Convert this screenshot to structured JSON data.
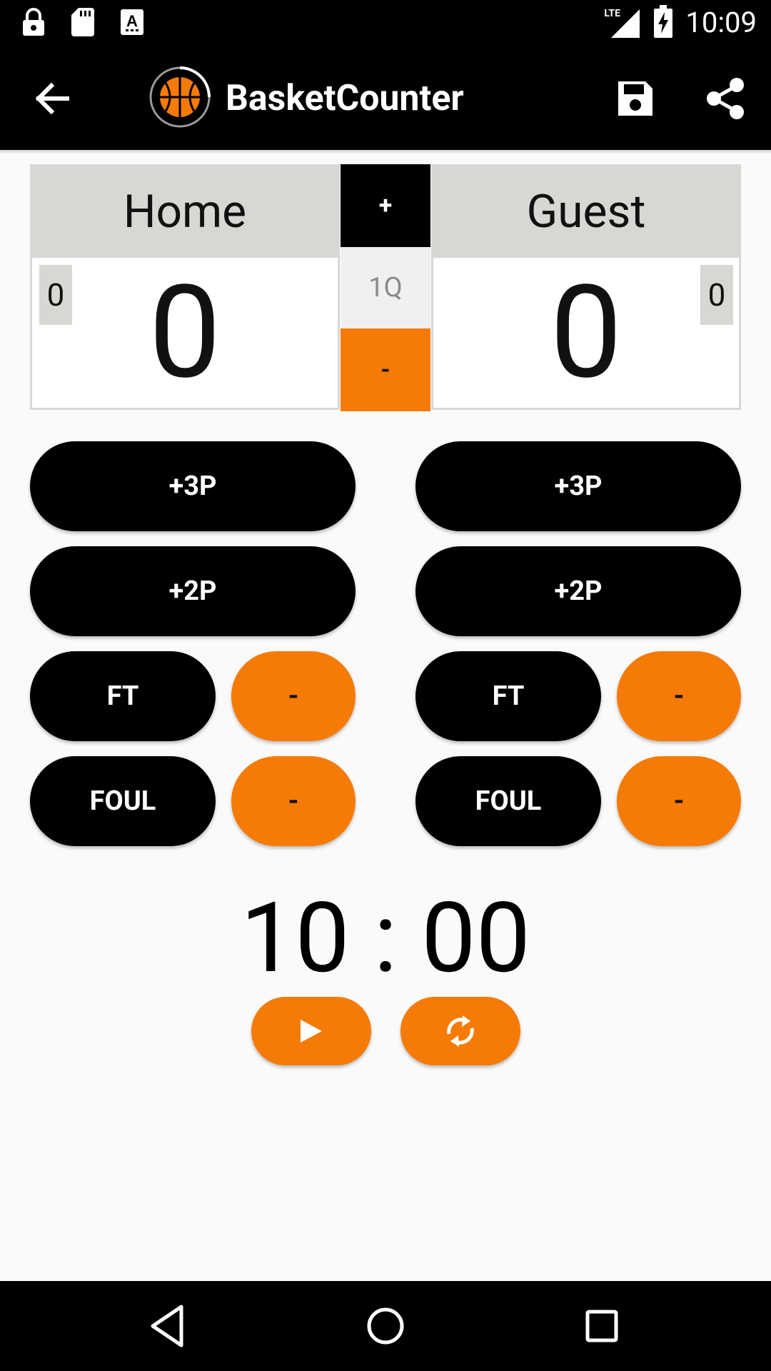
{
  "status_bar": {
    "time": "10:09",
    "network": "LTE",
    "icons": [
      "lock-icon",
      "sd-card-icon",
      "keyboard-a-icon",
      "signal-icon",
      "battery-charging-icon"
    ]
  },
  "app_bar": {
    "title": "BasketCounter",
    "icons": [
      "back-arrow-icon",
      "basketball-logo-icon",
      "save-icon",
      "share-icon"
    ]
  },
  "scoreboard": {
    "home": {
      "name": "Home",
      "score": "0",
      "fouls": "0"
    },
    "guest": {
      "name": "Guest",
      "score": "0",
      "fouls": "0"
    },
    "quarter": {
      "plus_label": "+",
      "value": "1Q",
      "minus_label": "-"
    }
  },
  "controls": {
    "home": {
      "three_label": "+3P",
      "two_label": "+2P",
      "ft_label": "FT",
      "ft_minus_label": "-",
      "foul_label": "FOUL",
      "foul_minus_label": "-"
    },
    "guest": {
      "three_label": "+3P",
      "two_label": "+2P",
      "ft_label": "FT",
      "ft_minus_label": "-",
      "foul_label": "FOUL",
      "foul_minus_label": "-"
    }
  },
  "timer": {
    "value": "10 : 00",
    "icons": [
      "play-icon",
      "reset-icon"
    ]
  },
  "nav_bar": {
    "icons": [
      "nav-back-icon",
      "nav-home-icon",
      "nav-recents-icon"
    ]
  },
  "colors": {
    "accent": "#f57b06",
    "dark": "#000000",
    "panel_gray": "#d6d8d3",
    "background": "#fafafa"
  }
}
